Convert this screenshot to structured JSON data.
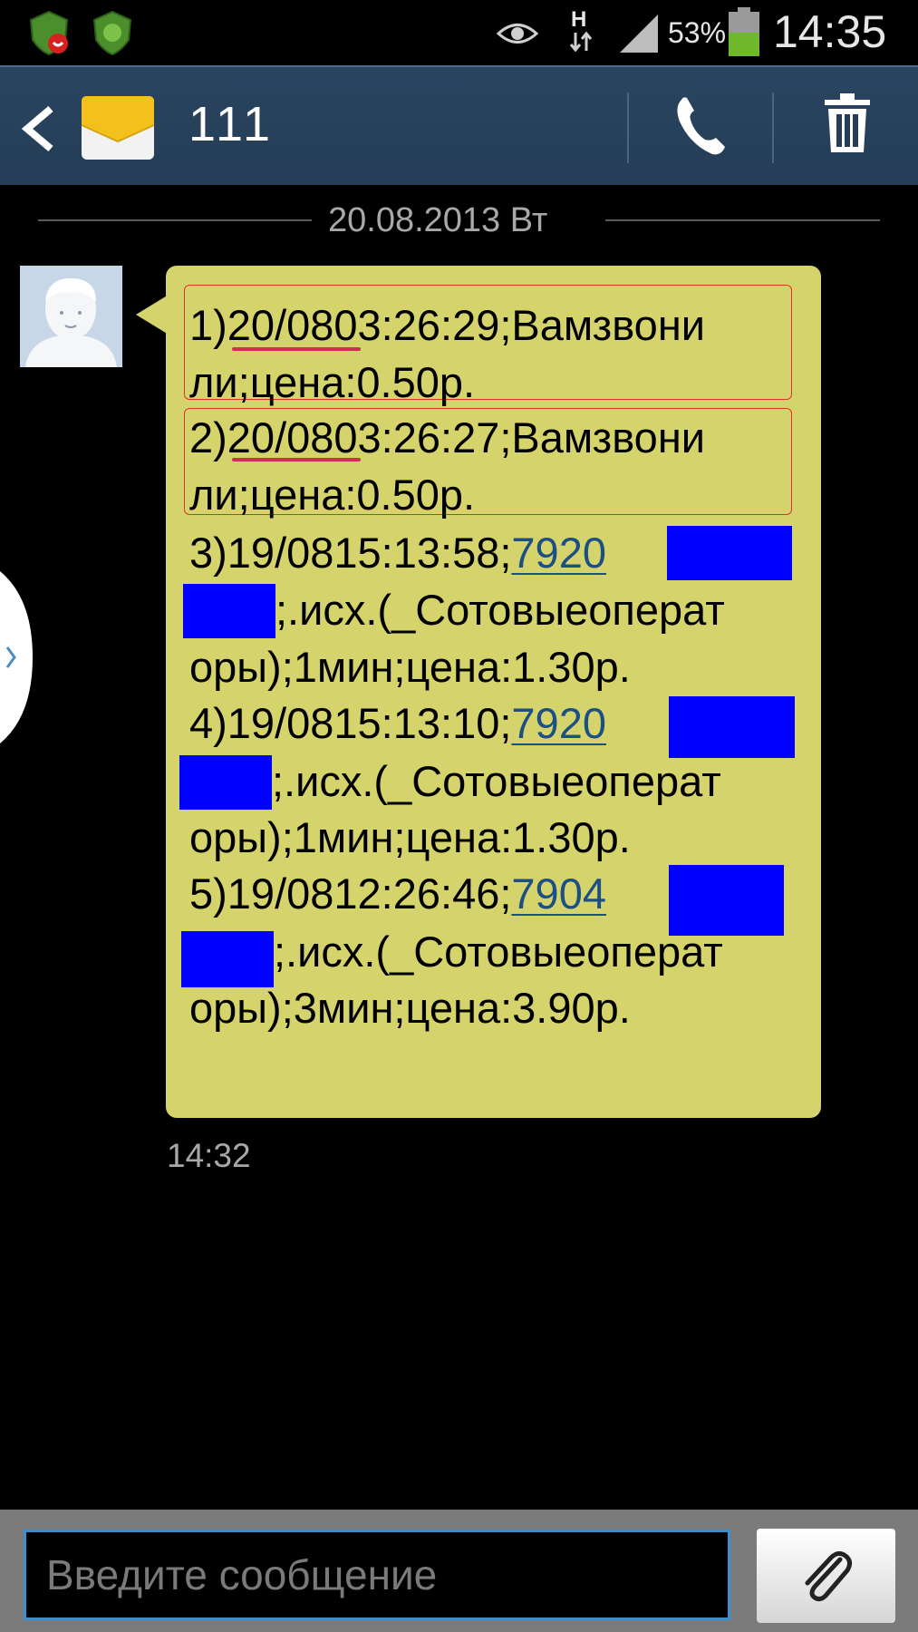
{
  "status_bar": {
    "network_label": "H",
    "battery_percent": "53%",
    "time": "14:35",
    "battery_level": 0.53,
    "icons": [
      "shield-call-icon",
      "shield-icon",
      "eye-icon",
      "data-arrows-icon",
      "signal-icon",
      "battery-icon"
    ]
  },
  "action_bar": {
    "title": "111",
    "icons": [
      "back-icon",
      "envelope-icon",
      "call-icon",
      "trash-icon"
    ]
  },
  "conversation": {
    "date_header": "20.08.2013 Вт",
    "timestamp": "14:32",
    "lines": [
      "1)20/0803:26:29;Вамзвони",
      "ли;цена:0.50р.",
      "2)20/0803:26:27;Вамзвони",
      "ли;цена:0.50р.",
      "3)19/0815:13:58;",
      "7920",
      ";.исх.(_Сотовыеоперат",
      "оры);1мин;цена:1.30р.",
      "4)19/0815:13:10;",
      "7920",
      ";.исх.(_Сотовыеоперат",
      "оры);1мин;цена:1.30р.",
      "5)19/0812:26:46;",
      "7904",
      ";.исх.(_Сотовыеоперат",
      "оры);3мин;цена:3.90р."
    ]
  },
  "composer": {
    "placeholder": "Введите сообщение"
  },
  "colors": {
    "bubble": "#d5d36c",
    "action_bar": "#2a4561",
    "link": "#1c4f84",
    "redaction": "#0000ff",
    "highlight_box": "#e0322a",
    "input_border": "#3a8fd0"
  }
}
